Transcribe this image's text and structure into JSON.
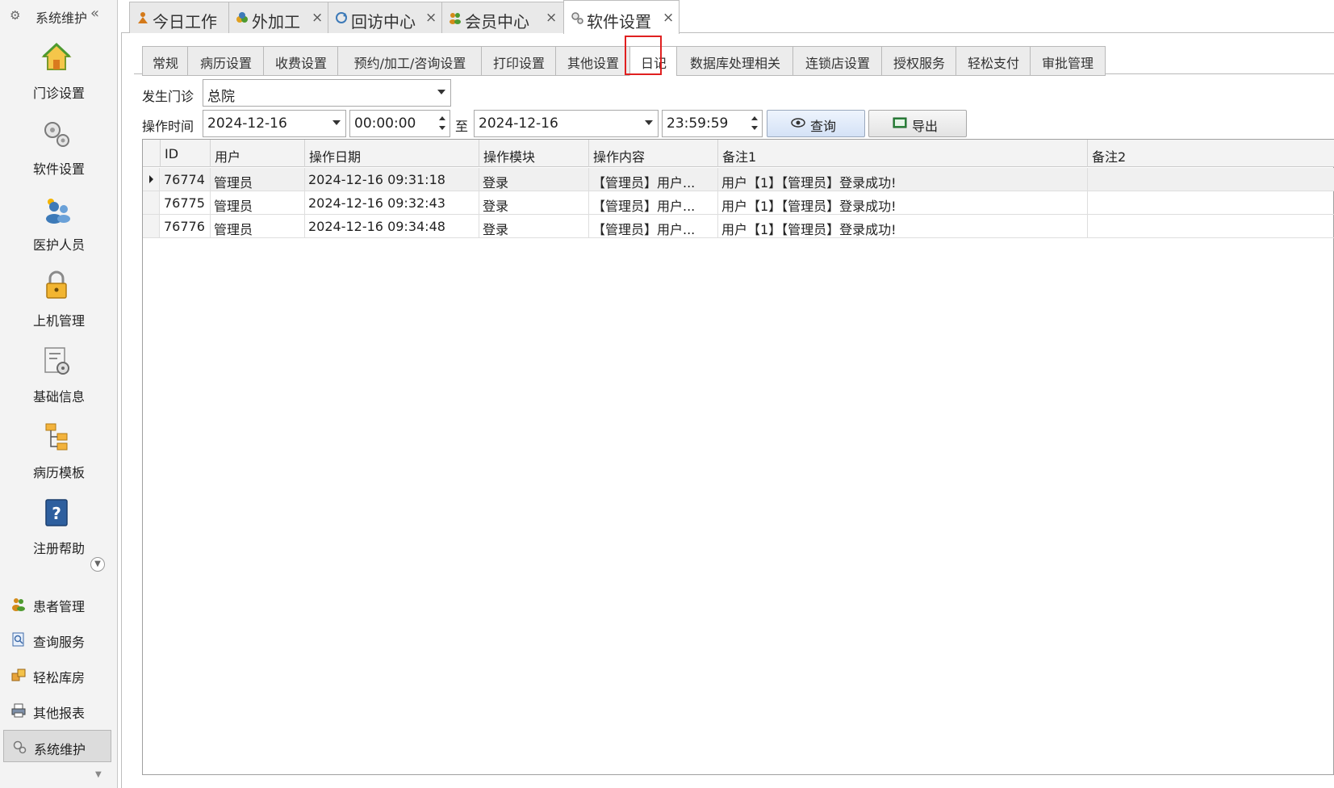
{
  "sidebar": {
    "title": "系统维护",
    "collapse_icon": "double-chevron-left-icon",
    "big_items": [
      {
        "label": "门诊设置",
        "icon": "house-icon"
      },
      {
        "label": "软件设置",
        "icon": "gears-icon"
      },
      {
        "label": "医护人员",
        "icon": "staff-icon"
      },
      {
        "label": "上机管理",
        "icon": "padlock-icon"
      },
      {
        "label": "基础信息",
        "icon": "settings-card-icon"
      },
      {
        "label": "病历模板",
        "icon": "tree-icon"
      },
      {
        "label": "注册帮助",
        "icon": "help-book-icon"
      }
    ],
    "small_items": [
      {
        "label": "患者管理",
        "icon": "patients-icon"
      },
      {
        "label": "查询服务",
        "icon": "search-doc-icon"
      },
      {
        "label": "轻松库房",
        "icon": "boxes-icon"
      },
      {
        "label": "其他报表",
        "icon": "printer-icon"
      },
      {
        "label": "系统维护",
        "icon": "gears-icon",
        "active": true
      }
    ]
  },
  "doc_tabs": [
    {
      "label": "今日工作",
      "icon": "person-icon"
    },
    {
      "label": "外加工",
      "icon": "molecule-icon"
    },
    {
      "label": "回访中心",
      "icon": "refresh-icon"
    },
    {
      "label": "会员中心",
      "icon": "members-icon"
    },
    {
      "label": "软件设置",
      "icon": "gears-icon",
      "active": true
    }
  ],
  "tab_close_glyph": "×",
  "inner_tabs": [
    "常规",
    "病历设置",
    "收费设置",
    "预约/加工/咨询设置",
    "打印设置",
    "其他设置",
    "日记",
    "数据库处理相关",
    "连锁店设置",
    "授权服务",
    "轻松支付",
    "审批管理"
  ],
  "inner_tab_active": "日记",
  "filters": {
    "clinic_label": "发生门诊",
    "clinic_value": "总院",
    "time_label": "操作时间",
    "start_date": "2024-12-16",
    "start_time": "00:00:00",
    "to_label": "至",
    "end_date": "2024-12-16",
    "end_time": "23:59:59",
    "query_button": "查询",
    "export_button": "导出"
  },
  "grid": {
    "columns": [
      "ID",
      "用户",
      "操作日期",
      "操作模块",
      "操作内容",
      "备注1",
      "备注2"
    ],
    "rows": [
      [
        "76774",
        "管理员",
        "2024-12-16 09:31:18",
        "登录",
        "【管理员】用户...",
        "用户【1】【管理员】登录成功!",
        ""
      ],
      [
        "76775",
        "管理员",
        "2024-12-16 09:32:43",
        "登录",
        "【管理员】用户...",
        "用户【1】【管理员】登录成功!",
        ""
      ],
      [
        "76776",
        "管理员",
        "2024-12-16 09:34:48",
        "登录",
        "【管理员】用户...",
        "用户【1】【管理员】登录成功!",
        ""
      ]
    ],
    "selected_row": 0
  },
  "colors": {
    "highlight": "#e02020",
    "accent": "#d4e2f6"
  }
}
